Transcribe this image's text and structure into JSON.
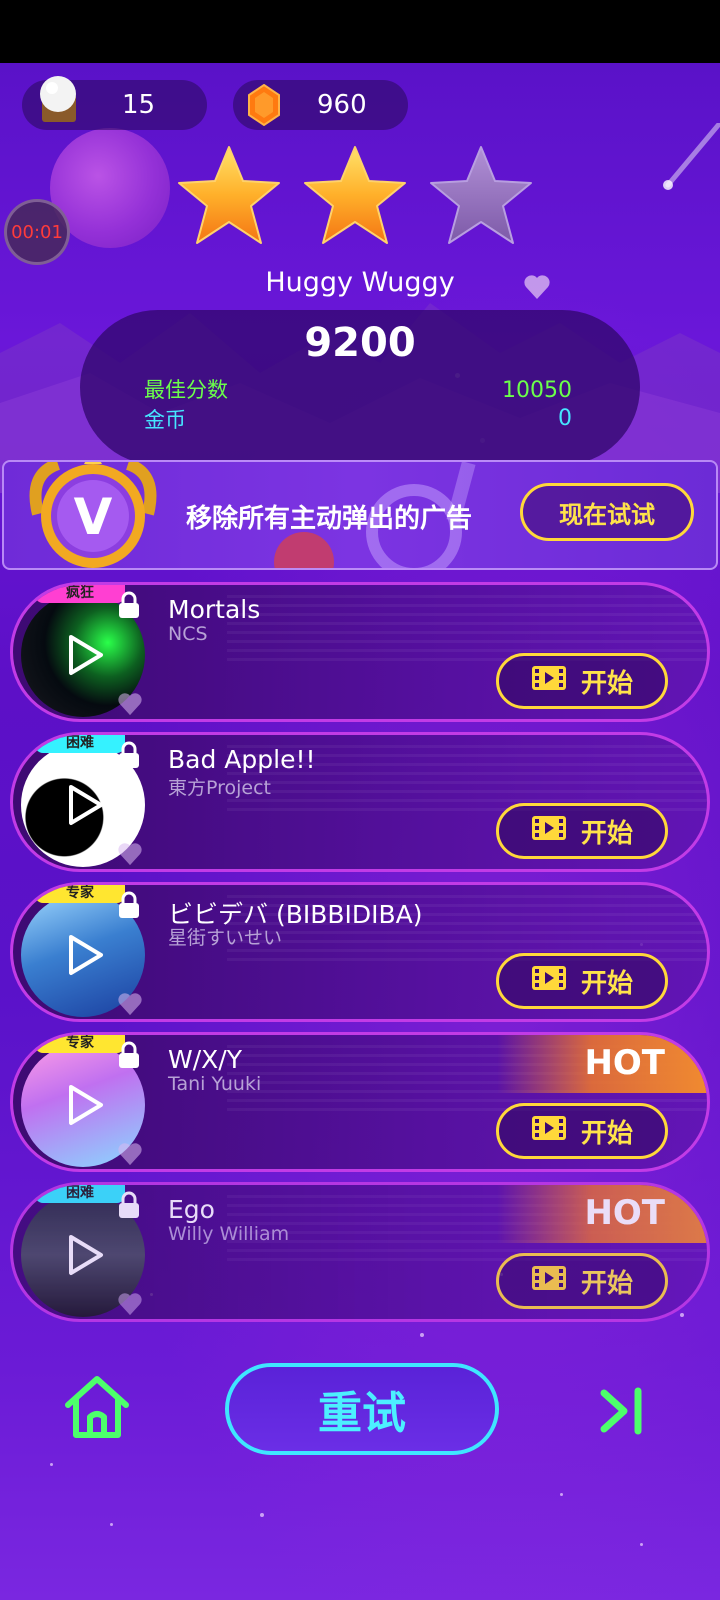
{
  "top_bar": {
    "lives_count": "15",
    "gems_count": "960",
    "timer": "00:01"
  },
  "result": {
    "stars_earned": 2,
    "stars_total": 3,
    "song_title": "Huggy Wuggy",
    "score": "9200",
    "best_score_label": "最佳分数",
    "best_score_value": "10050",
    "coins_label": "金币",
    "coins_value": "0"
  },
  "vip_banner": {
    "text": "移除所有主动弹出的广告",
    "button_label": "现在试试"
  },
  "songs": [
    {
      "difficulty": "疯狂",
      "difficulty_color": "#ff3fd2",
      "title": "Mortals",
      "artist": "NCS",
      "button": "开始",
      "hot": false,
      "locked": true
    },
    {
      "difficulty": "困难",
      "difficulty_color": "#35f2ff",
      "title": "Bad Apple!!",
      "artist": "東方Project",
      "button": "开始",
      "hot": false,
      "locked": true
    },
    {
      "difficulty": "专家",
      "difficulty_color": "#ffe630",
      "title": "ビビデバ (BIBBIDIBA)",
      "artist": "星街すいせい",
      "button": "开始",
      "hot": false,
      "locked": true
    },
    {
      "difficulty": "专家",
      "difficulty_color": "#ffe630",
      "title": "W/X/Y",
      "artist": "Tani Yuuki",
      "button": "开始",
      "hot": true,
      "hot_label": "HOT",
      "locked": true
    },
    {
      "difficulty": "困难",
      "difficulty_color": "#35f2ff",
      "title": "Ego",
      "artist": "Willy William",
      "button": "开始",
      "hot": true,
      "hot_label": "HOT",
      "locked": true
    }
  ],
  "bottom_nav": {
    "retry_label": "重试"
  },
  "colors": {
    "accent_yellow": "#ffd83a",
    "accent_cyan": "#3fe6ff",
    "accent_green": "#5dff5a",
    "background": "#5d10c7"
  },
  "icons": [
    "gem-icon",
    "lives-icon",
    "star-icon",
    "heart-icon",
    "lock-icon",
    "video-ad-icon",
    "home-icon",
    "next-icon",
    "vip-badge-icon"
  ]
}
